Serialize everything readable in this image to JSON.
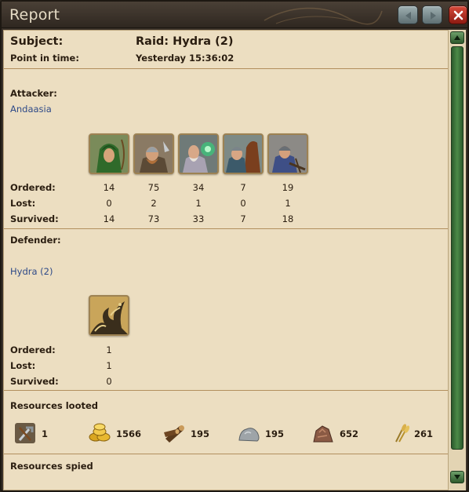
{
  "window": {
    "title": "Report",
    "prev_icon": "triangle-left-icon",
    "next_icon": "triangle-right-icon",
    "close_icon": "close-x-icon"
  },
  "header": {
    "subject_label": "Subject:",
    "subject_value": "Raid: Hydra (2)",
    "time_label": "Point in time:",
    "time_value": "Yesterday 15:36:02"
  },
  "attacker": {
    "label": "Attacker:",
    "name": "Andaasia",
    "units": [
      {
        "icon": "archer-unit-icon",
        "ordered": "14",
        "lost": "0",
        "survived": "14"
      },
      {
        "icon": "viking-warrior-unit-icon",
        "ordered": "75",
        "lost": "2",
        "survived": "73"
      },
      {
        "icon": "mage-unit-icon",
        "ordered": "34",
        "lost": "1",
        "survived": "33"
      },
      {
        "icon": "cavalry-unit-icon",
        "ordered": "7",
        "lost": "0",
        "survived": "7"
      },
      {
        "icon": "crossbowman-unit-icon",
        "ordered": "19",
        "lost": "1",
        "survived": "18"
      }
    ]
  },
  "defender": {
    "label": "Defender:",
    "name": "Hydra (2)",
    "units": [
      {
        "icon": "hydra-unit-icon",
        "ordered": "1",
        "lost": "1",
        "survived": "0"
      }
    ]
  },
  "row_labels": {
    "ordered": "Ordered:",
    "lost": "Lost:",
    "survived": "Survived:"
  },
  "resources_looted": {
    "label": "Resources looted",
    "items": [
      {
        "icon": "tools-icon",
        "value": "1"
      },
      {
        "icon": "gold-coins-icon",
        "value": "1566"
      },
      {
        "icon": "wood-logs-icon",
        "value": "195"
      },
      {
        "icon": "stone-icon",
        "value": "195"
      },
      {
        "icon": "ore-icon",
        "value": "652"
      },
      {
        "icon": "grain-icon",
        "value": "261"
      }
    ]
  },
  "resources_spied": {
    "label": "Resources spied"
  },
  "colors": {
    "parchment": "#ecdec1",
    "link": "#2e4a88",
    "scroll_green": "#4c8a48",
    "close_red": "#c23a2c"
  }
}
